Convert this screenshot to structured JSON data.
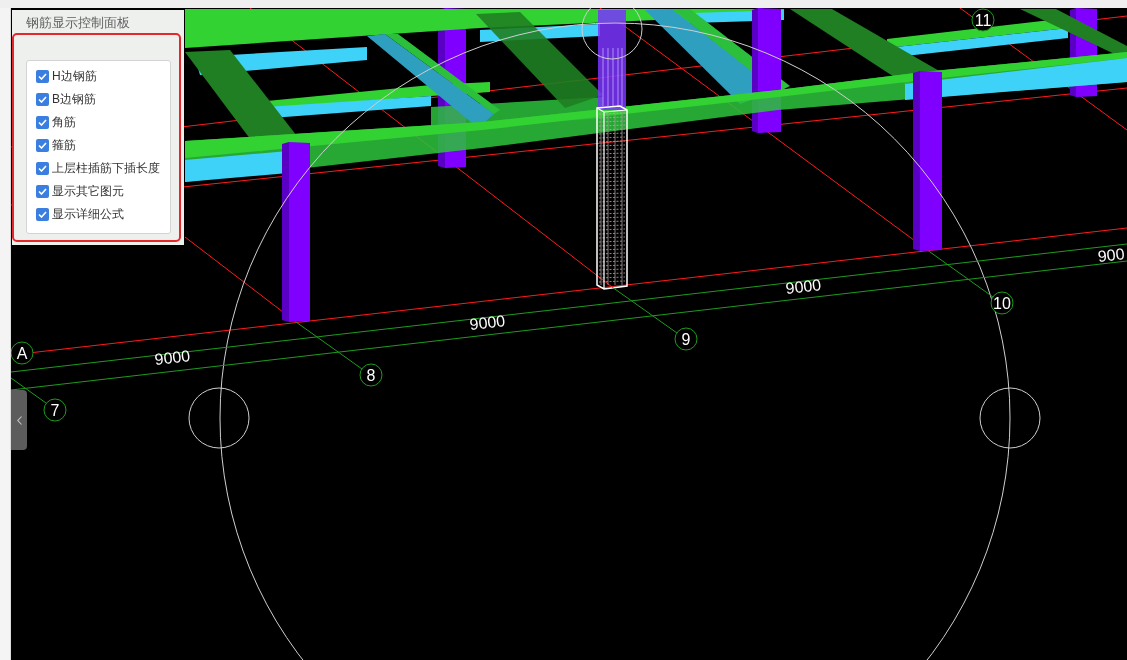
{
  "control_panel": {
    "title": "钢筋显示控制面板",
    "options": [
      {
        "label": "H边钢筋",
        "checked": true
      },
      {
        "label": "B边钢筋",
        "checked": true
      },
      {
        "label": "角筋",
        "checked": true
      },
      {
        "label": "箍筋",
        "checked": true
      },
      {
        "label": "上层柱插筋下插长度",
        "checked": true
      },
      {
        "label": "显示其它图元",
        "checked": true
      },
      {
        "label": "显示详细公式",
        "checked": true
      }
    ]
  },
  "viewport": {
    "axis_labels": [
      "A",
      "7",
      "8",
      "9",
      "10",
      "11"
    ],
    "dimension_labels": [
      "9000",
      "9000",
      "9000",
      "900"
    ]
  }
}
